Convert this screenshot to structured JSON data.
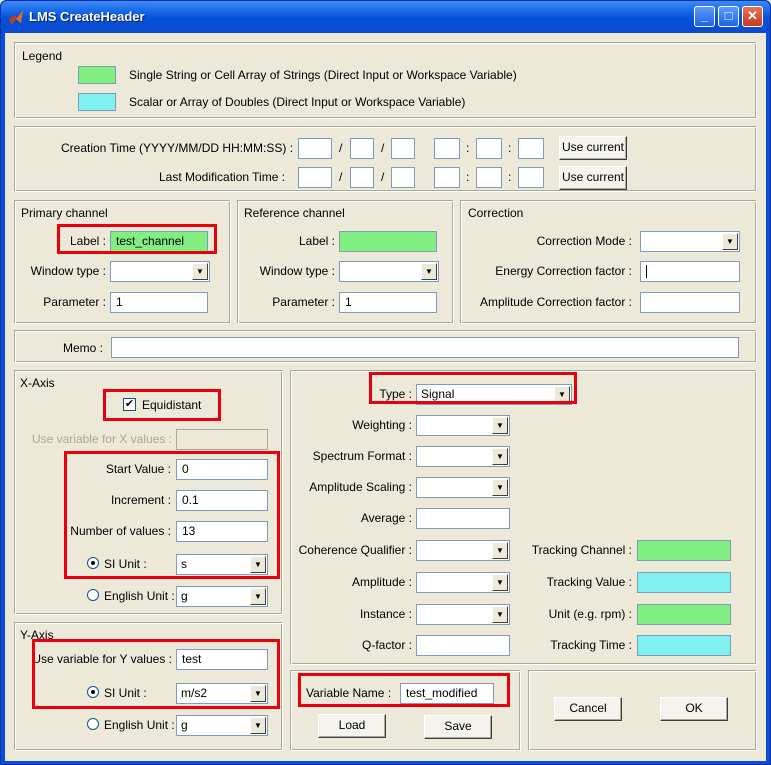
{
  "window": {
    "title": "LMS CreateHeader",
    "minimize": "_",
    "maximize": "□",
    "close": "✕"
  },
  "legend": {
    "title": "Legend",
    "items": [
      {
        "color": "#80ee80",
        "text": "Single String or Cell Array of Strings (Direct Input or Workspace Variable)"
      },
      {
        "color": "#80f0f0",
        "text": "Scalar or Array of Doubles (Direct Input or Workspace Variable)"
      }
    ]
  },
  "time": {
    "creation_label": "Creation Time (YYYY/MM/DD HH:MM:SS) :",
    "modification_label": "Last Modification Time :",
    "date_sep": "/",
    "time_sep": ":",
    "use_current": "Use current"
  },
  "primary": {
    "title": "Primary channel",
    "label_label": "Label :",
    "label_value": "test_channel",
    "window_label": "Window type :",
    "window_value": "",
    "param_label": "Parameter :",
    "param_value": "1"
  },
  "reference": {
    "title": "Reference channel",
    "label_label": "Label :",
    "label_value": "",
    "window_label": "Window type :",
    "window_value": "",
    "param_label": "Parameter :",
    "param_value": "1"
  },
  "correction": {
    "title": "Correction",
    "mode_label": "Correction Mode :",
    "mode_value": "",
    "energy_label": "Energy Correction factor :",
    "energy_value": "",
    "amp_label": "Amplitude Correction factor :",
    "amp_value": ""
  },
  "memo": {
    "label": "Memo :",
    "value": ""
  },
  "xaxis": {
    "title": "X-Axis",
    "equidistant_label": "Equidistant",
    "use_var_label": "Use variable for X values :",
    "use_var_value": "",
    "start_label": "Start Value :",
    "start_value": "0",
    "incr_label": "Increment :",
    "incr_value": "0.1",
    "num_label": "Number of values :",
    "num_value": "13",
    "si_label": "SI Unit :",
    "si_value": "s",
    "en_label": "English Unit :",
    "en_value": "g"
  },
  "yaxis": {
    "title": "Y-Axis",
    "use_var_label": "Use variable for Y values :",
    "use_var_value": "test",
    "si_label": "SI Unit :",
    "si_value": "m/s2",
    "en_label": "English Unit :",
    "en_value": "g"
  },
  "props": {
    "type_label": "Type :",
    "type_value": "Signal",
    "weighting_label": "Weighting :",
    "spectrum_label": "Spectrum Format :",
    "ampscale_label": "Amplitude Scaling :",
    "average_label": "Average :",
    "coherence_label": "Coherence Qualifier :",
    "amplitude_label": "Amplitude :",
    "instance_label": "Instance :",
    "qfactor_label": "Q-factor :",
    "track_channel_label": "Tracking Channel :",
    "track_value_label": "Tracking Value :",
    "unit_label": "Unit (e.g. rpm) :",
    "track_time_label": "Tracking Time :"
  },
  "variable": {
    "label": "Variable Name :",
    "value": "test_modified",
    "load": "Load",
    "save": "Save"
  },
  "actions": {
    "cancel": "Cancel",
    "ok": "OK"
  },
  "arrow_glyph": "▼",
  "check_glyph": "✔"
}
